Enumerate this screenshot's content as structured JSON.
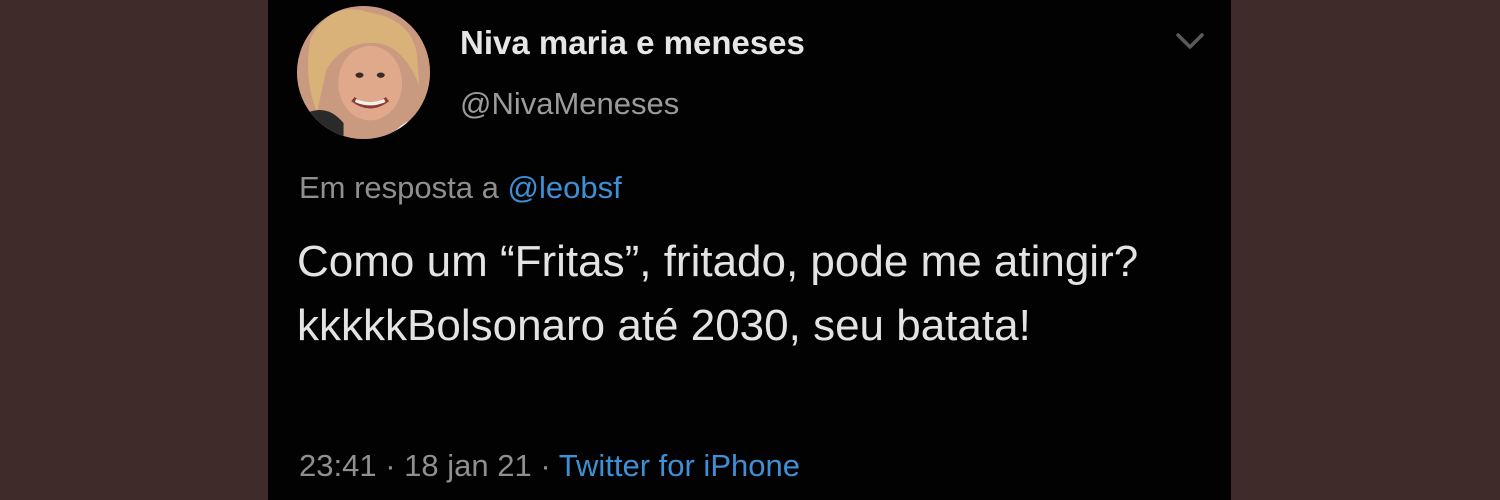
{
  "tweet": {
    "author": {
      "display_name": "Niva maria e meneses",
      "handle": "@NivaMeneses"
    },
    "reply": {
      "prefix": "Em resposta a",
      "mention": "@leobsf"
    },
    "text": "Como um “Fritas”, fritado, pode me atingir?kkkkkBolsonaro até 2030, seu batata!",
    "meta": {
      "time": "23:41",
      "separator": "·",
      "date": "18 jan 21",
      "source": "Twitter for iPhone"
    },
    "icons": {
      "menu": "chevron-down-icon",
      "avatar": "avatar"
    }
  },
  "colors": {
    "page_background": "#3f2b29",
    "card_background": "#020202",
    "primary_text": "#e3e3e3",
    "secondary_text": "#8f8f8f",
    "link": "#3d8fd6"
  }
}
